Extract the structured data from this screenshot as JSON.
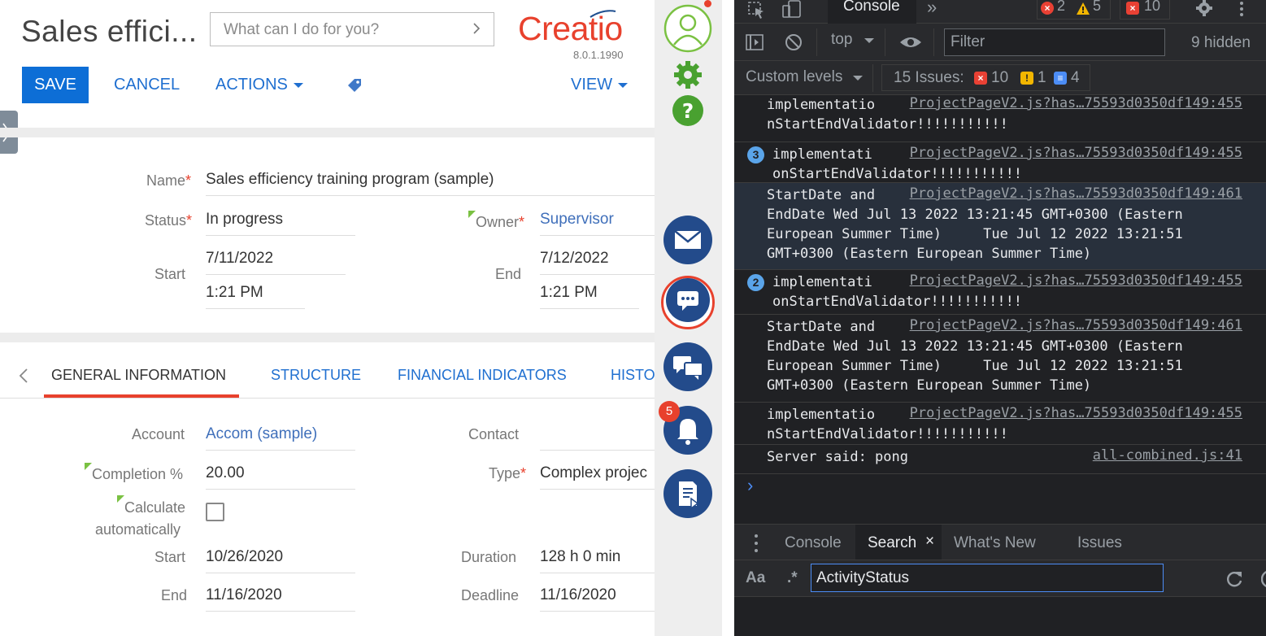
{
  "page": {
    "title": "Sales effici...",
    "search_placeholder": "What can I do for you?",
    "logo": "Creatio",
    "version": "8.0.1.1990"
  },
  "toolbar": {
    "save": "SAVE",
    "cancel": "CANCEL",
    "actions": "ACTIONS",
    "view": "VIEW"
  },
  "header_fields": {
    "name_label": "Name",
    "name_value": "Sales efficiency training program (sample)",
    "status_label": "Status",
    "status_value": "In progress",
    "owner_label": "Owner",
    "owner_value": "Supervisor",
    "start_label": "Start",
    "start_date": "7/11/2022",
    "start_time": "1:21 PM",
    "end_label": "End",
    "end_date": "7/12/2022",
    "end_time": "1:21 PM",
    "required_mark": "*"
  },
  "tabs": [
    {
      "label": "GENERAL INFORMATION"
    },
    {
      "label": "STRUCTURE"
    },
    {
      "label": "FINANCIAL INDICATORS"
    },
    {
      "label": "HISTO"
    }
  ],
  "general": {
    "account_label": "Account",
    "account_value": "Accom (sample)",
    "contact_label": "Contact",
    "completion_label": "Completion %",
    "completion_value": "20.00",
    "type_label": "Type",
    "type_value": "Complex projec",
    "calc_label_1": "Calculate",
    "calc_label_2": "automatically",
    "calc_checked": false,
    "start_label": "Start",
    "start_value": "10/26/2020",
    "duration_label": "Duration",
    "duration_value": "128 h 0 min",
    "end_label": "End",
    "end_value": "11/16/2020",
    "deadline_label": "Deadline",
    "deadline_value": "11/16/2020"
  },
  "rightbar": {
    "notifications_count": "5",
    "icons": [
      "profile-icon",
      "settings-gear-icon",
      "help-icon",
      "email-icon",
      "chat-icon",
      "feed-icon",
      "notifications-bell-icon",
      "process-icon"
    ]
  },
  "devtools": {
    "tab_console": "Console",
    "errors": "2",
    "warnings": "5",
    "issues_top": "10",
    "context": "top",
    "filter_placeholder": "Filter",
    "hidden": "9 hidden",
    "levels": "Custom levels",
    "issues_label": "15 Issues:",
    "issues_err": "10",
    "issues_warn": "1",
    "issues_info": "4",
    "messages": [
      {
        "count": "",
        "lines": [
          "implementatio",
          "nStartEndValidator!!!!!!!!!!!"
        ],
        "src": "ProjectPageV2.js?has…75593d0350df149:455"
      },
      {
        "count": "3",
        "lines": [
          "implementati",
          "onStartEndValidator!!!!!!!!!!!"
        ],
        "src": "ProjectPageV2.js?has…75593d0350df149:455"
      },
      {
        "count": "",
        "lines": [
          "StartDate and",
          "EndDate Wed Jul 13 2022 13:21:45 GMT+0300 (Eastern",
          "European Summer Time)     Tue Jul 12 2022 13:21:51",
          "GMT+0300 (Eastern European Summer Time)"
        ],
        "src": "ProjectPageV2.js?has…75593d0350df149:461"
      },
      {
        "count": "2",
        "lines": [
          "implementati",
          "onStartEndValidator!!!!!!!!!!!"
        ],
        "src": "ProjectPageV2.js?has…75593d0350df149:455"
      },
      {
        "count": "",
        "lines": [
          "StartDate and",
          "EndDate Wed Jul 13 2022 13:21:45 GMT+0300 (Eastern",
          "European Summer Time)     Tue Jul 12 2022 13:21:51",
          "GMT+0300 (Eastern European Summer Time)"
        ],
        "src": "ProjectPageV2.js?has…75593d0350df149:461"
      },
      {
        "count": "",
        "lines": [
          "implementatio",
          "nStartEndValidator!!!!!!!!!!!"
        ],
        "src": "ProjectPageV2.js?has…75593d0350df149:455"
      },
      {
        "count": "",
        "lines": [
          "Server said: pong"
        ],
        "src": "all-combined.js:41"
      }
    ],
    "prompt": "›",
    "drawer_tabs": [
      "Console",
      "Search",
      "What's New",
      "Issues"
    ],
    "search_case": "Aa",
    "search_regex": ".*",
    "search_value": "ActivityStatus"
  },
  "colors": {
    "accent_blue": "#0d6ed6",
    "brand_red": "#e8412d",
    "link_blue": "#3f6fba",
    "devtools_bg": "#202124"
  }
}
